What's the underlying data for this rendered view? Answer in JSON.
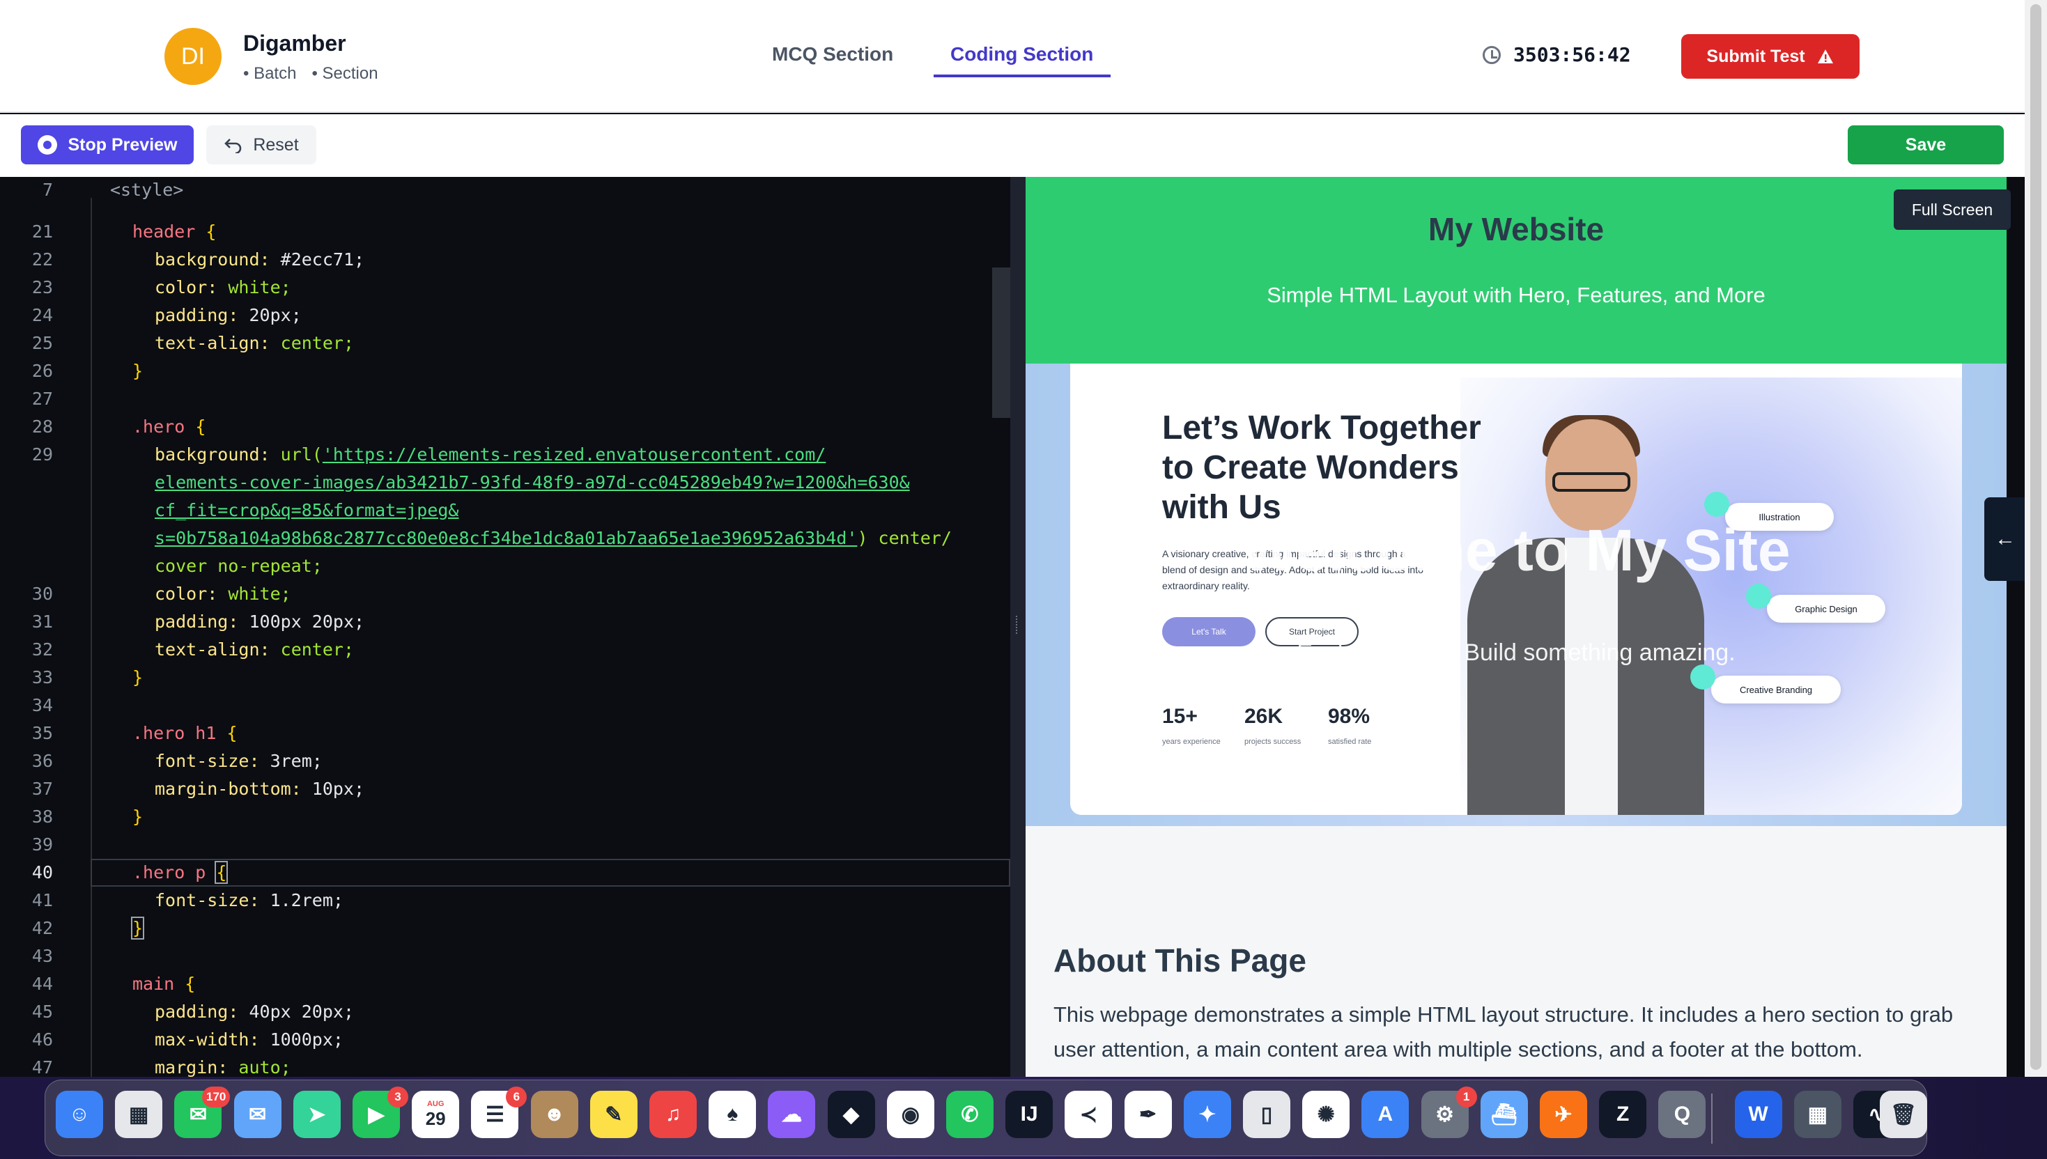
{
  "user": {
    "initials": "DI",
    "name": "Digamber",
    "batch": "• Batch",
    "section": "• Section"
  },
  "tabs": [
    {
      "label": "MCQ Section",
      "active": false
    },
    {
      "label": "Coding Section",
      "active": true
    }
  ],
  "timer": {
    "icon": "clock-icon",
    "value": "3503:56:42"
  },
  "submit": {
    "label": "Submit Test",
    "icon": "warning-icon",
    "color": "#dc2626"
  },
  "toolbar": {
    "stop_label": "Stop Preview",
    "reset_label": "Reset",
    "save_label": "Save"
  },
  "editor": {
    "active_line": "40",
    "line_numbers": [
      "7",
      "21",
      "22",
      "23",
      "24",
      "25",
      "26",
      "27",
      "28",
      "29",
      "30",
      "31",
      "32",
      "33",
      "34",
      "35",
      "36",
      "37",
      "38",
      "39",
      "40",
      "41",
      "42",
      "43",
      "44",
      "45",
      "46",
      "47"
    ],
    "lines": {
      "l7": "<style>",
      "l21_sel": "header",
      "l22_prop": "background:",
      "l22_val": "#2ecc71;",
      "l23_prop": "color:",
      "l23_val": "white;",
      "l24_prop": "padding:",
      "l24_val": "20px;",
      "l25_prop": "text-align:",
      "l25_val": "center;",
      "l28_sel": ".hero",
      "l29_prop": "background:",
      "l29_fn": "url(",
      "l29_url1": "'https://elements-resized.envatousercontent.com/",
      "l29_url2": "elements-cover-images/ab3421b7-93fd-48f9-a97d-cc045289eb49?w=1200&h=630&",
      "l29_url3": "cf_fit=crop&q=85&format=jpeg&",
      "l29_url4": "s=0b758a104a98b68c2877cc80e0e8cf34be1dc8a01ab7aa65e1ae396952a63b4d'",
      "l29_tail": ") center/",
      "l29_cont": "cover no-repeat;",
      "l30_prop": "color:",
      "l30_val": "white;",
      "l31_prop": "padding:",
      "l31_val": "100px 20px;",
      "l32_prop": "text-align:",
      "l32_val": "center;",
      "l35_sel": ".hero h1",
      "l36_prop": "font-size:",
      "l36_val": "3rem;",
      "l37_prop": "margin-bottom:",
      "l37_val": "10px;",
      "l40_sel": ".hero p",
      "l41_prop": "font-size:",
      "l41_val": "1.2rem;",
      "l44_sel": "main",
      "l45_prop": "padding:",
      "l45_val": "40px 20px;",
      "l46_prop": "max-width:",
      "l46_val": "1000px;",
      "l47_prop": "margin:",
      "l47_val": "auto;",
      "open_brace": "{",
      "close_brace": "}"
    }
  },
  "preview": {
    "site_title": "My Website",
    "site_subtitle": "Simple HTML Layout with Hero, Features, and More",
    "hero_h1": "Welcome to My Site",
    "hero_p": "Explore. Learn. Build something amazing.",
    "card": {
      "heading": "Let’s Work Together to Create Wonders with Us",
      "body": "A visionary creative, crafting impactful designs through a blend of design and strategy. Adopt at turning bold ideas into extraordinary reality.",
      "btn_primary": "Let's Talk",
      "btn_secondary": "Start Project",
      "stats": [
        {
          "value": "15+",
          "label": "years experience"
        },
        {
          "value": "26K",
          "label": "projects success"
        },
        {
          "value": "98%",
          "label": "satisfied rate"
        }
      ],
      "pills": [
        "Illustration",
        "Graphic Design",
        "Creative Branding"
      ]
    },
    "about_heading": "About This Page",
    "about_text": "This webpage demonstrates a simple HTML layout structure. It includes a hero section to grab user attention, a main content area with multiple sections, and a footer at the bottom.",
    "fullscreen_label": "Full Screen"
  },
  "dock": {
    "apps": [
      {
        "name": "finder-icon",
        "color": "#3b82f6",
        "glyph": "☺"
      },
      {
        "name": "launchpad-icon",
        "color": "#e5e7eb",
        "glyph": "▦"
      },
      {
        "name": "messages-icon",
        "color": "#22c55e",
        "glyph": "✉",
        "badge": "170"
      },
      {
        "name": "mail-icon",
        "color": "#60a5fa",
        "glyph": "✉"
      },
      {
        "name": "maps-icon",
        "color": "#34d399",
        "glyph": "➤"
      },
      {
        "name": "facetime-icon",
        "color": "#22c55e",
        "glyph": "▶",
        "badge": "3"
      },
      {
        "name": "calendar-icon",
        "color": "#ffffff",
        "glyph": "29",
        "sub": "AUG"
      },
      {
        "name": "reminders-icon",
        "color": "#ffffff",
        "glyph": "☰",
        "badge": "6"
      },
      {
        "name": "contacts-icon",
        "color": "#b08a5a",
        "glyph": "☻"
      },
      {
        "name": "notes-icon",
        "color": "#fde047",
        "glyph": "✎"
      },
      {
        "name": "music-icon",
        "color": "#ef4444",
        "glyph": "♫"
      },
      {
        "name": "mongodb-icon",
        "color": "#ffffff",
        "glyph": "♠"
      },
      {
        "name": "ghost-app-icon",
        "color": "#8b5cf6",
        "glyph": "☁"
      },
      {
        "name": "cube-app-icon",
        "color": "#111827",
        "glyph": "◆"
      },
      {
        "name": "chrome-icon",
        "color": "#ffffff",
        "glyph": "◉"
      },
      {
        "name": "whatsapp-icon",
        "color": "#22c55e",
        "glyph": "✆"
      },
      {
        "name": "intellij-icon",
        "color": "#111827",
        "glyph": "IJ"
      },
      {
        "name": "vscode-icon",
        "color": "#ffffff",
        "glyph": "≺"
      },
      {
        "name": "writer-app-icon",
        "color": "#ffffff",
        "glyph": "✒"
      },
      {
        "name": "safari-icon",
        "color": "#3b82f6",
        "glyph": "✦"
      },
      {
        "name": "iphone-mirroring-icon",
        "color": "#e5e7eb",
        "glyph": "▯"
      },
      {
        "name": "chatgpt-icon",
        "color": "#ffffff",
        "glyph": "✺"
      },
      {
        "name": "app-store-icon",
        "color": "#3b82f6",
        "glyph": "A"
      },
      {
        "name": "system-settings-icon",
        "color": "#6b7280",
        "glyph": "⚙",
        "badge": "1"
      },
      {
        "name": "docker-icon",
        "color": "#60a5fa",
        "glyph": "⛴"
      },
      {
        "name": "postman-icon",
        "color": "#f97316",
        "glyph": "✈"
      },
      {
        "name": "zed-icon",
        "color": "#111827",
        "glyph": "Z"
      },
      {
        "name": "quicktime-icon",
        "color": "#6b7280",
        "glyph": "Q"
      },
      {
        "name": "word-icon",
        "color": "#2563eb",
        "glyph": "W"
      },
      {
        "name": "calculator-icon",
        "color": "#4b5563",
        "glyph": "▦"
      },
      {
        "name": "activity-monitor-icon",
        "color": "#111827",
        "glyph": "∿"
      },
      {
        "name": "trash-icon",
        "color": "#e5e7eb",
        "glyph": "🗑"
      }
    ]
  }
}
